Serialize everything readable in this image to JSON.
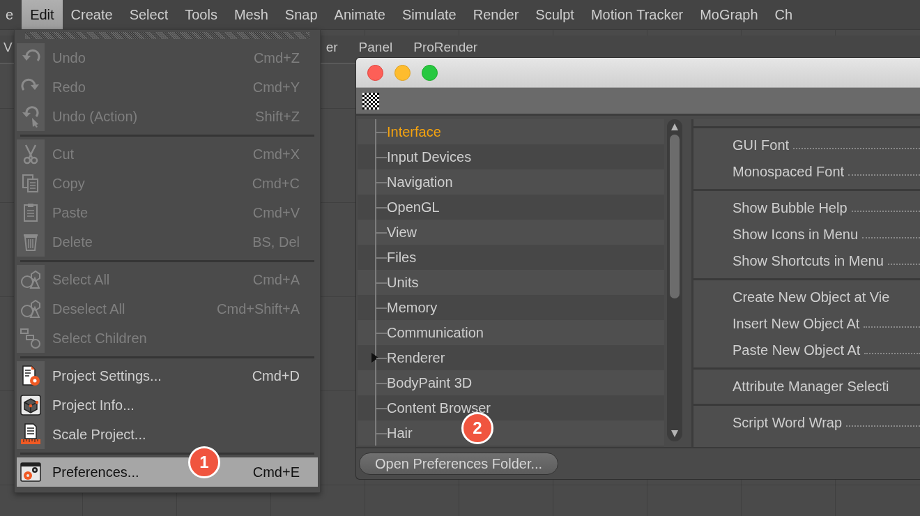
{
  "menu_bar": {
    "items": [
      {
        "label": "e",
        "selected": false
      },
      {
        "label": "Edit",
        "selected": true
      },
      {
        "label": "Create",
        "selected": false
      },
      {
        "label": "Select",
        "selected": false
      },
      {
        "label": "Tools",
        "selected": false
      },
      {
        "label": "Mesh",
        "selected": false
      },
      {
        "label": "Snap",
        "selected": false
      },
      {
        "label": "Animate",
        "selected": false
      },
      {
        "label": "Simulate",
        "selected": false
      },
      {
        "label": "Render",
        "selected": false
      },
      {
        "label": "Sculpt",
        "selected": false
      },
      {
        "label": "Motion Tracker",
        "selected": false
      },
      {
        "label": "MoGraph",
        "selected": false
      },
      {
        "label": "Ch",
        "selected": false
      }
    ]
  },
  "toolbar": {
    "items": [
      "V",
      "er",
      "Panel",
      "ProRender"
    ]
  },
  "edit_menu": {
    "items": [
      {
        "kind": "item",
        "label": "Undo",
        "shortcut": "Cmd+Z",
        "disabled": true,
        "selected": false
      },
      {
        "kind": "item",
        "label": "Redo",
        "shortcut": "Cmd+Y",
        "disabled": true,
        "selected": false
      },
      {
        "kind": "item",
        "label": "Undo (Action)",
        "shortcut": "Shift+Z",
        "disabled": true,
        "selected": false
      },
      {
        "kind": "separator"
      },
      {
        "kind": "item",
        "label": "Cut",
        "shortcut": "Cmd+X",
        "disabled": true,
        "selected": false
      },
      {
        "kind": "item",
        "label": "Copy",
        "shortcut": "Cmd+C",
        "disabled": true,
        "selected": false
      },
      {
        "kind": "item",
        "label": "Paste",
        "shortcut": "Cmd+V",
        "disabled": true,
        "selected": false
      },
      {
        "kind": "item",
        "label": "Delete",
        "shortcut": "BS, Del",
        "disabled": true,
        "selected": false
      },
      {
        "kind": "separator"
      },
      {
        "kind": "item",
        "label": "Select All",
        "shortcut": "Cmd+A",
        "disabled": true,
        "selected": false
      },
      {
        "kind": "item",
        "label": "Deselect All",
        "shortcut": "Cmd+Shift+A",
        "disabled": true,
        "selected": false
      },
      {
        "kind": "item",
        "label": "Select Children",
        "disabled": true,
        "selected": false
      },
      {
        "kind": "separator"
      },
      {
        "kind": "item",
        "label": "Project Settings...",
        "shortcut": "Cmd+D",
        "disabled": false,
        "selected": false
      },
      {
        "kind": "item",
        "label": "Project Info...",
        "disabled": false,
        "selected": false
      },
      {
        "kind": "item",
        "label": "Scale Project...",
        "disabled": false,
        "selected": false
      },
      {
        "kind": "separator"
      },
      {
        "kind": "item",
        "label": "Preferences...",
        "shortcut": "Cmd+E",
        "disabled": false,
        "selected": true
      }
    ]
  },
  "callouts": [
    "1",
    "2"
  ],
  "preferences_window": {
    "tree": [
      {
        "label": "Interface",
        "selected": true,
        "has_children": false
      },
      {
        "label": "Input Devices",
        "selected": false,
        "has_children": false
      },
      {
        "label": "Navigation",
        "selected": false,
        "has_children": false
      },
      {
        "label": "OpenGL",
        "selected": false,
        "has_children": false
      },
      {
        "label": "View",
        "selected": false,
        "has_children": false
      },
      {
        "label": "Files",
        "selected": false,
        "has_children": false
      },
      {
        "label": "Units",
        "selected": false,
        "has_children": false
      },
      {
        "label": "Memory",
        "selected": false,
        "has_children": false
      },
      {
        "label": "Communication",
        "selected": false,
        "has_children": false
      },
      {
        "label": "Renderer",
        "selected": false,
        "has_children": true
      },
      {
        "label": "BodyPaint 3D",
        "selected": false,
        "has_children": false
      },
      {
        "label": "Content Browser",
        "selected": false,
        "has_children": false
      },
      {
        "label": "Hair",
        "selected": false,
        "has_children": false
      }
    ],
    "settings_groups": [
      {
        "items": [
          {
            "label": "GUI Font",
            "leader": true
          },
          {
            "label": "Monospaced Font",
            "leader": true
          }
        ]
      },
      {
        "items": [
          {
            "label": "Show Bubble Help",
            "leader": true
          },
          {
            "label": "Show Icons in Menu",
            "leader": true
          },
          {
            "label": "Show Shortcuts in Menu",
            "leader": true
          }
        ]
      },
      {
        "items": [
          {
            "label": "Create New Object at Vie",
            "leader": false
          },
          {
            "label": "Insert New Object At",
            "leader": true
          },
          {
            "label": "Paste New Object At",
            "leader": true
          }
        ]
      },
      {
        "items": [
          {
            "label": "Attribute Manager Selecti",
            "leader": false
          }
        ]
      },
      {
        "items": [
          {
            "label": "Script Word Wrap",
            "leader": true
          }
        ]
      }
    ],
    "button": "Open Preferences Folder..."
  }
}
